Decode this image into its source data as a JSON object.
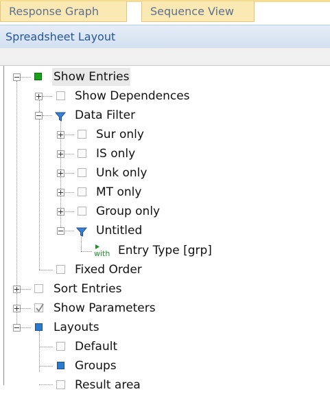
{
  "tabs": [
    {
      "label": "Response Graph"
    },
    {
      "label": "Sequence View"
    }
  ],
  "section_title": "Spreadsheet Layout",
  "tree": {
    "items": [
      {
        "label": "Show Entries",
        "icon": "green-square-icon",
        "expander": "minus",
        "selected": true
      },
      {
        "label": "Show Dependences",
        "icon": "checkbox-icon",
        "expander": "plus"
      },
      {
        "label": "Data Filter",
        "icon": "funnel-icon",
        "expander": "minus"
      },
      {
        "label": "Sur only",
        "icon": "checkbox-icon",
        "expander": "plus"
      },
      {
        "label": "IS only",
        "icon": "checkbox-icon",
        "expander": "plus"
      },
      {
        "label": "Unk only",
        "icon": "checkbox-icon",
        "expander": "plus"
      },
      {
        "label": "MT only",
        "icon": "checkbox-icon",
        "expander": "plus"
      },
      {
        "label": "Group only",
        "icon": "checkbox-icon",
        "expander": "plus"
      },
      {
        "label": "Untitled",
        "icon": "funnel-icon",
        "expander": "minus"
      },
      {
        "label": "Entry Type [grp]",
        "icon": "with-icon",
        "icon_text": "with"
      },
      {
        "label": "Fixed Order",
        "icon": "checkbox-icon"
      },
      {
        "label": "Sort Entries",
        "icon": "checkbox-icon",
        "expander": "plus"
      },
      {
        "label": "Show Parameters",
        "icon": "checkmark-icon",
        "expander": "plus"
      },
      {
        "label": "Layouts",
        "icon": "blue-square-icon",
        "expander": "minus"
      },
      {
        "label": "Default",
        "icon": "checkbox-icon"
      },
      {
        "label": "Groups",
        "icon": "blue-square-icon"
      },
      {
        "label": "Result area",
        "icon": "checkbox-icon"
      }
    ]
  },
  "colors": {
    "tab_bg": "#fae9b2",
    "section_text": "#25559a",
    "green": "#1aa31a",
    "blue": "#2b7ad0"
  }
}
